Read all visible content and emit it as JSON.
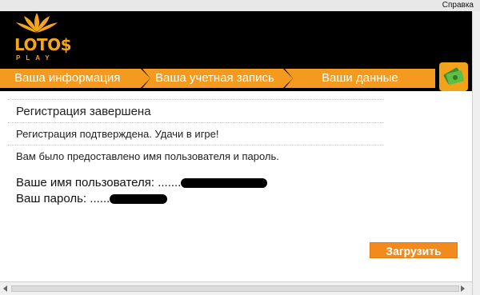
{
  "titlebar": {
    "help_label": "Справка"
  },
  "logo": {
    "text": "LOTO$",
    "sub": "PLAY"
  },
  "steps": [
    {
      "label": "Ваша информация"
    },
    {
      "label": "Ваша учетная запись"
    },
    {
      "label": "Ваши данные"
    }
  ],
  "icons": {
    "badge": "money-bills-icon",
    "flower": "lotus-flower-icon"
  },
  "colors": {
    "accent": "#f5a51a",
    "step_bg": "#f39a1f",
    "button": "#f28a1e"
  },
  "content": {
    "heading": "Регистрация завершена",
    "confirm": "Регистрация подтверждена. Удачи в игре!",
    "info": "Вам было предоставлено имя пользователя и пароль.",
    "username_label": "Ваше имя пользователя: .......",
    "password_label": "Ваш пароль: ......"
  },
  "actions": {
    "download_label": "Загрузить"
  }
}
